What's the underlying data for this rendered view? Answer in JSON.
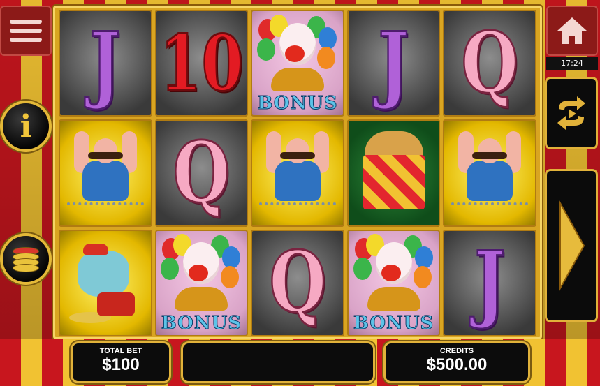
{
  "game": {
    "symbols": {
      "bonus_label": "BONUS",
      "letter_j": "J",
      "letter_q": "Q",
      "number_ten": "10"
    },
    "reels": [
      [
        "J",
        "strongman",
        "elephant"
      ],
      [
        "10",
        "Q",
        "clown-bonus"
      ],
      [
        "clown-bonus",
        "strongman",
        "Q"
      ],
      [
        "J",
        "popcorn",
        "clown-bonus"
      ],
      [
        "Q",
        "strongman",
        "J"
      ]
    ]
  },
  "controls": {
    "menu_icon": "hamburger-icon",
    "home_icon": "home-icon",
    "info_glyph": "i",
    "coin_icon": "coin-stack-icon",
    "autoplay_icon": "autoplay-icon",
    "spin_icon": "play-arrow-icon"
  },
  "status": {
    "clock": "17:24"
  },
  "footer": {
    "total_bet_label": "TOTAL BET",
    "total_bet_value": "$100",
    "message": "",
    "credits_label": "CREDITS",
    "credits_value": "$500.00"
  },
  "colors": {
    "stripe_red": "#c8161e",
    "stripe_yellow": "#f1c232",
    "gold_border": "#e1b23a",
    "panel_bg": "#0c0c0c"
  }
}
